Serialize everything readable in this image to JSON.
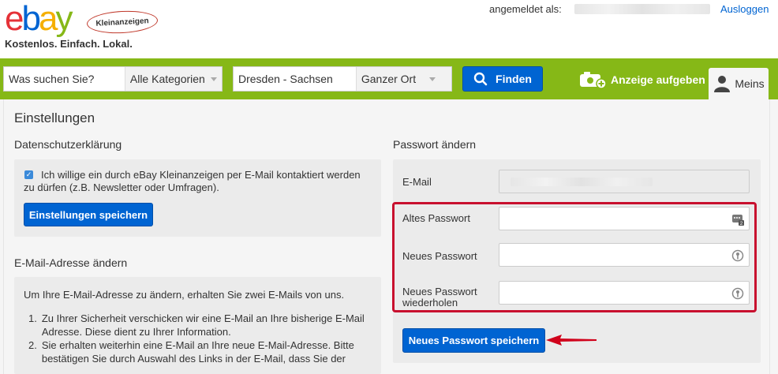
{
  "header": {
    "tagline": "Kostenlos. Einfach. Lokal.",
    "logo_badge": "Kleinanzeigen",
    "logged_in_label": "angemeldet als:",
    "logout_link": "Ausloggen"
  },
  "search": {
    "query_placeholder": "Was suchen Sie?",
    "category_selected": "Alle Kategorien",
    "location_value": "Dresden - Sachsen",
    "radius_selected": "Ganzer Ort",
    "find_button": "Finden"
  },
  "nav": {
    "post_ad": "Anzeige aufgeben",
    "my_tab": "Meins"
  },
  "page": {
    "title": "Einstellungen",
    "privacy": {
      "heading": "Datenschutzerklärung",
      "consent_text": "Ich willige ein durch eBay Kleinanzeigen per E-Mail kontaktiert werden zu dürfen (z.B. Newsletter oder Umfragen).",
      "save_button": "Einstellungen speichern"
    },
    "email_change": {
      "heading": "E-Mail-Adresse ändern",
      "intro": "Um Ihre E-Mail-Adresse zu ändern, erhalten Sie zwei E-Mails von uns.",
      "steps": [
        "Zu Ihrer Sicherheit verschicken wir eine E-Mail an Ihre bisherige E-Mail Adresse. Diese dient zu Ihrer Information.",
        "Sie erhalten weiterhin eine E-Mail an Ihre neue E-Mail-Adresse. Bitte bestätigen Sie durch Auswahl des Links in der E-Mail, dass Sie der"
      ]
    },
    "password_change": {
      "heading": "Passwort ändern",
      "email_label": "E-Mail",
      "old_password_label": "Altes Passwort",
      "new_password_label": "Neues Passwort",
      "repeat_password_label": "Neues Passwort wiederholen",
      "save_button": "Neues Passwort speichern"
    }
  },
  "colors": {
    "brand_green": "#86b817",
    "primary_blue": "#0064d2",
    "highlight_red": "#c8102e"
  }
}
